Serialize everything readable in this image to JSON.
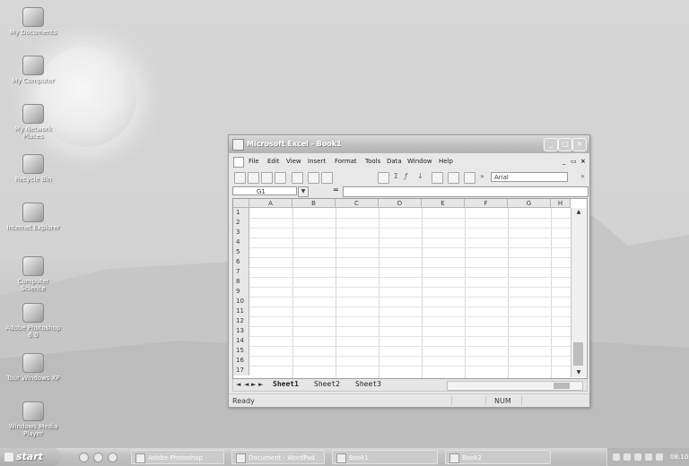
{
  "desktop": {
    "icons": [
      {
        "label": "My Documents"
      },
      {
        "label": "My Computer"
      },
      {
        "label": "My Network Places"
      },
      {
        "label": "Recycle Bin"
      },
      {
        "label": "Internet Explorer"
      },
      {
        "label": "Computer Science"
      },
      {
        "label": "Adobe Photoshop 6.0"
      },
      {
        "label": "Tour Windows XP"
      },
      {
        "label": "Windows Media Player"
      }
    ]
  },
  "window": {
    "title": "Microsoft Excel - Book1",
    "menu": [
      "File",
      "Edit",
      "View",
      "Insert",
      "Format",
      "Tools",
      "Data",
      "Window",
      "Help"
    ],
    "font_name": "Arial",
    "name_box": "G1",
    "formula_symbol": "=",
    "columns": [
      "A",
      "B",
      "C",
      "D",
      "E",
      "F",
      "G",
      "H"
    ],
    "rows": [
      "1",
      "2",
      "3",
      "4",
      "5",
      "6",
      "7",
      "8",
      "9",
      "10",
      "11",
      "12",
      "13",
      "14",
      "15",
      "16",
      "17"
    ],
    "sheets": [
      "Sheet1",
      "Sheet2",
      "Sheet3"
    ],
    "status": "Ready",
    "num_indicator": "NUM"
  },
  "taskbar": {
    "start_label": "start",
    "tasks": [
      {
        "label": "Adobe Photoshop"
      },
      {
        "label": "Document - WordPad"
      },
      {
        "label": "Book1"
      },
      {
        "label": "Book2"
      }
    ],
    "clock": "08:10"
  }
}
